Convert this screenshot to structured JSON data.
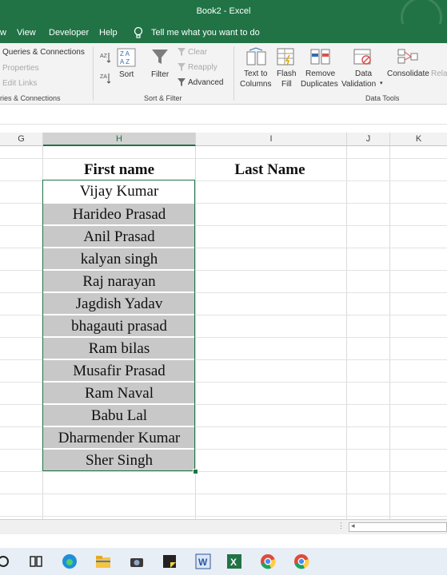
{
  "titlebar": {
    "title": "Book2 - Excel"
  },
  "menu": {
    "items": [
      "w",
      "View",
      "Developer",
      "Help"
    ],
    "tell_me": "Tell me what you want to do"
  },
  "ribbon": {
    "queries": {
      "connections": "Queries & Connections",
      "properties": "Properties",
      "edit_links": "Edit Links",
      "group_label": "ries & Connections"
    },
    "sort_filter": {
      "sort": "Sort",
      "filter": "Filter",
      "clear": "Clear",
      "reapply": "Reapply",
      "advanced": "Advanced",
      "group_label": "Sort & Filter"
    },
    "data_tools": {
      "text_to_columns_1": "Text to",
      "text_to_columns_2": "Columns",
      "flash_fill_1": "Flash",
      "flash_fill_2": "Fill",
      "remove_dup_1": "Remove",
      "remove_dup_2": "Duplicates",
      "data_val_1": "Data",
      "data_val_2": "Validation",
      "consolidate": "Consolidate",
      "relations": "Relat",
      "group_label": "Data Tools"
    }
  },
  "columns": [
    "G",
    "H",
    "I",
    "J",
    "K"
  ],
  "sheet": {
    "header_first": "First name",
    "header_last": "Last Name",
    "first_names": [
      "Vijay Kumar",
      "Harideo Prasad",
      "Anil Prasad",
      "kalyan singh",
      "Raj narayan",
      "Jagdish Yadav",
      "bhagauti prasad",
      "Ram bilas",
      "Musafir Prasad",
      "Ram Naval",
      "Babu Lal",
      "Dharmender Kumar",
      "Sher Singh"
    ]
  },
  "colors": {
    "excel_green": "#217346",
    "cell_fill": "#c8c8c8"
  }
}
